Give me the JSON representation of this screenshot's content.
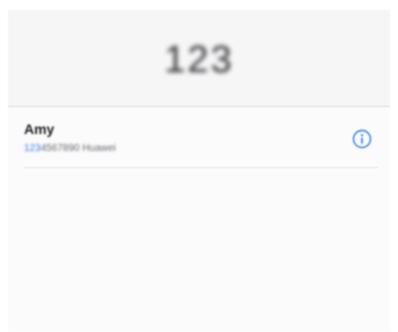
{
  "dialer": {
    "number": "123"
  },
  "results": [
    {
      "name": "Amy",
      "number_match": "123",
      "number_rest": "4567890",
      "carrier": "Huawei",
      "info_icon": "info-icon",
      "accent_color": "#2c7bf2"
    }
  ]
}
